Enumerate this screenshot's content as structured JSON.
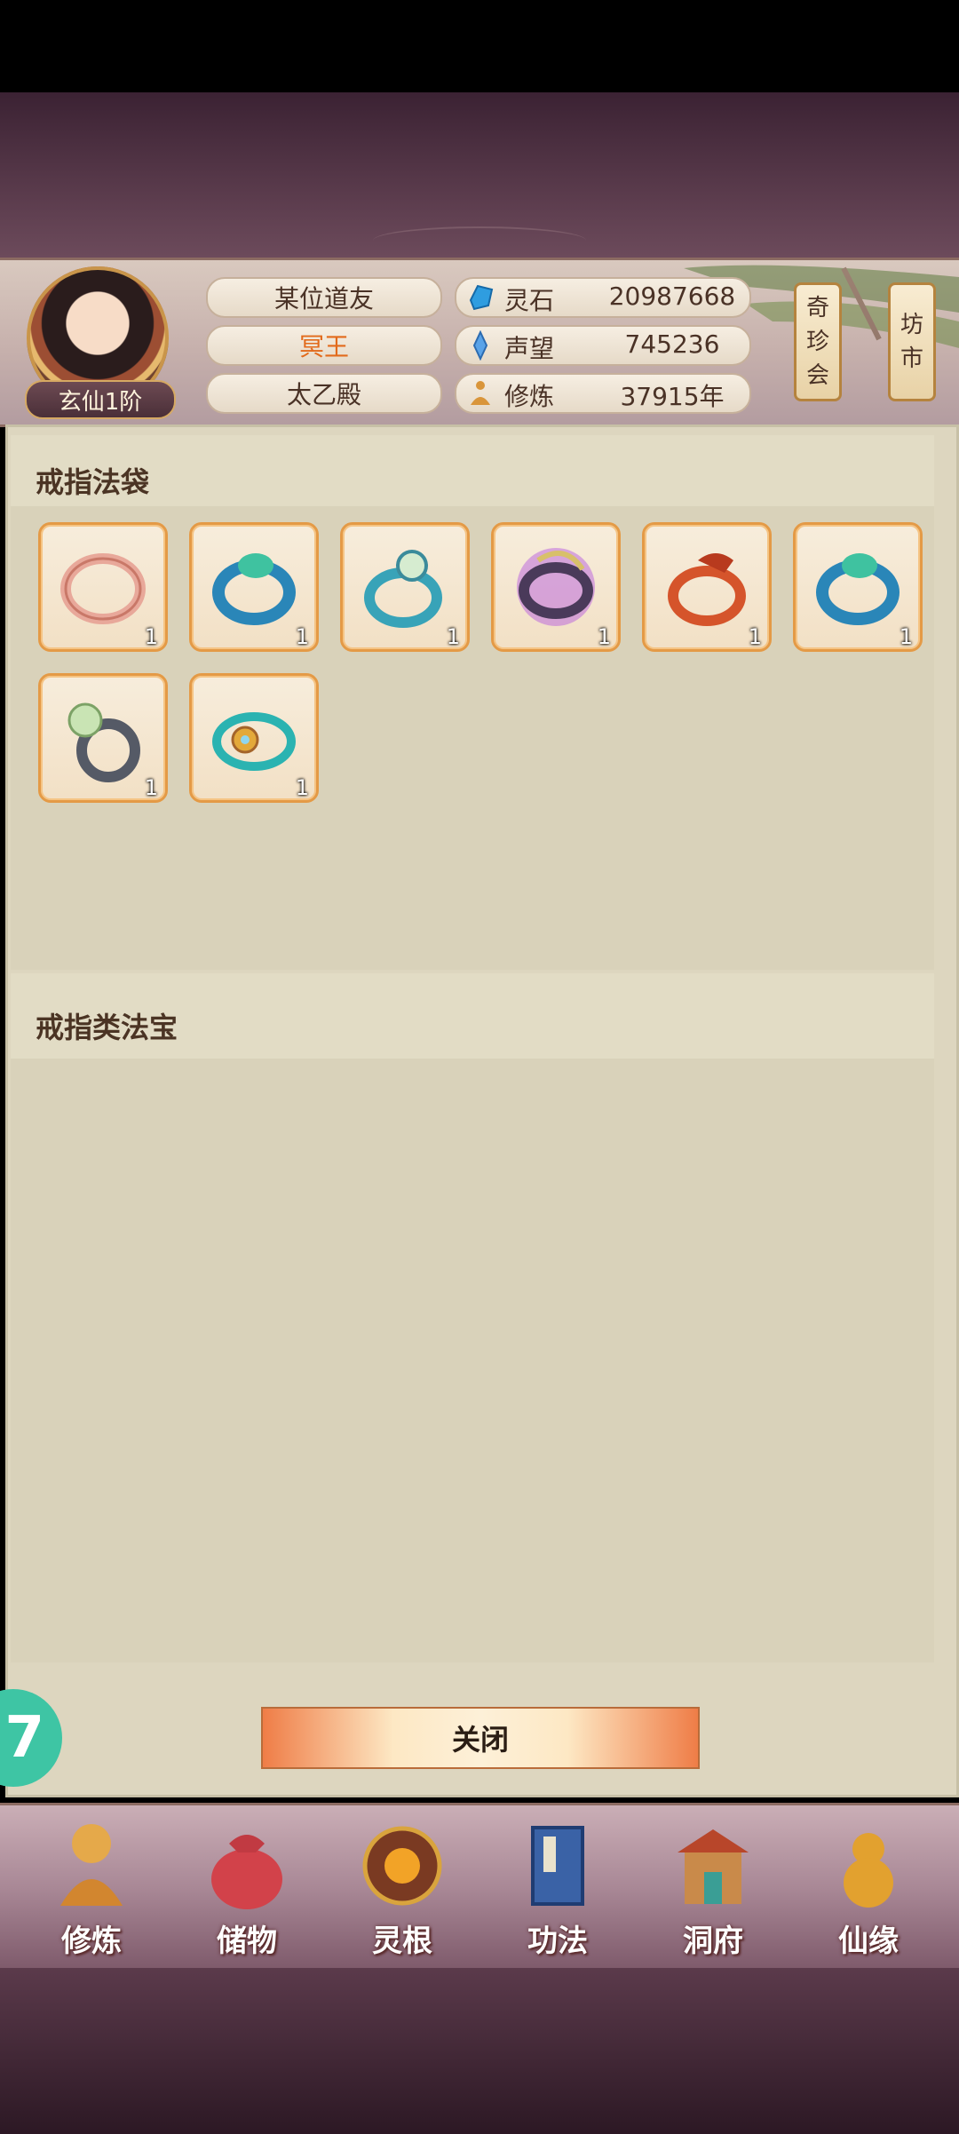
{
  "profile": {
    "name": "某位道友",
    "title": "冥王",
    "sect": "太乙殿",
    "rank": "玄仙1阶"
  },
  "resources": [
    {
      "label": "灵石",
      "value": "20987668",
      "icon": "spirit-stone-icon"
    },
    {
      "label": "声望",
      "value": "745236",
      "icon": "prestige-crystal-icon"
    },
    {
      "label": "修炼",
      "value": "37915年",
      "icon": "meditation-icon"
    }
  ],
  "side_buttons": {
    "qizhenhui": "奇珍会",
    "fangshi": "坊市"
  },
  "sections": {
    "ring_bag": "戒指法袋",
    "ring_treasures": "戒指类法宝"
  },
  "items": [
    {
      "icon": "pink-ring-icon",
      "count": "1"
    },
    {
      "icon": "blue-jade-ring-icon",
      "count": "1"
    },
    {
      "icon": "pearl-ring-icon",
      "count": "1"
    },
    {
      "icon": "purple-dragon-ring-icon",
      "count": "1"
    },
    {
      "icon": "red-dragon-ring-icon",
      "count": "1"
    },
    {
      "icon": "blue-jade-ring-icon",
      "count": "1"
    },
    {
      "icon": "green-pearl-ring-icon",
      "count": "1"
    },
    {
      "icon": "gold-gem-ring-icon",
      "count": "1"
    }
  ],
  "close_button": "关闭",
  "float_button": "7",
  "nav": [
    {
      "label": "修炼",
      "icon": "monk-icon"
    },
    {
      "label": "储物",
      "icon": "storage-bag-icon"
    },
    {
      "label": "灵根",
      "icon": "spirit-root-icon"
    },
    {
      "label": "功法",
      "icon": "book-icon"
    },
    {
      "label": "洞府",
      "icon": "cave-palace-icon"
    },
    {
      "label": "仙缘",
      "icon": "gourd-icon"
    }
  ],
  "colors": {
    "title_orange": "#e26a1b",
    "item_border": "#e49a46",
    "panel_bg": "#ddd6bf"
  }
}
